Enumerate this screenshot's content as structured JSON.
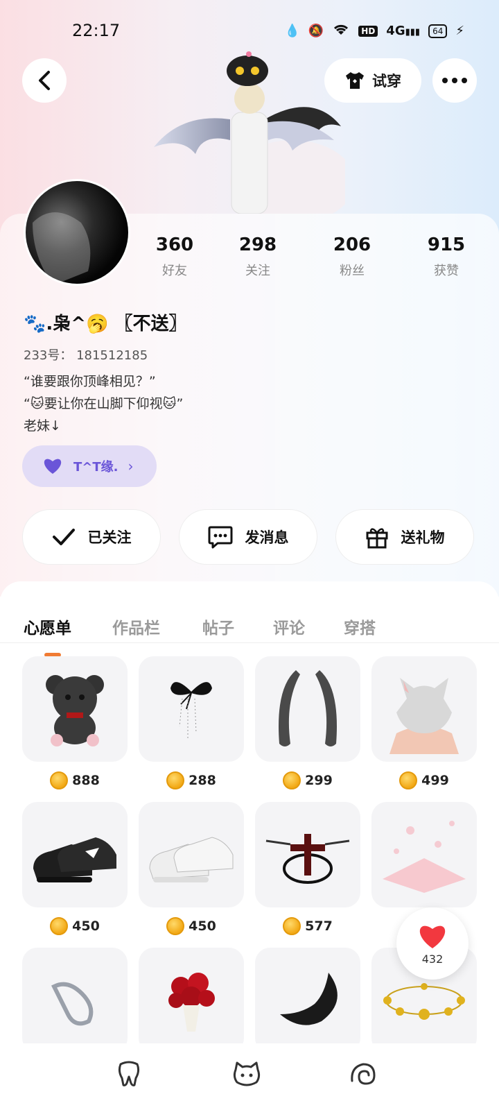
{
  "status_bar": {
    "time": "22:17",
    "network": "4G",
    "hd": "HD",
    "battery": "64"
  },
  "header": {
    "tryon_label": "试穿"
  },
  "profile": {
    "stats": [
      {
        "value": "360",
        "label": "好友"
      },
      {
        "value": "298",
        "label": "关注"
      },
      {
        "value": "206",
        "label": "粉丝"
      },
      {
        "value": "915",
        "label": "获赞"
      }
    ],
    "nickname": "🐾.枭^🥱 〖不送〗",
    "uid": "233号：  181512185",
    "bio": "“谁要跟你顶峰相见？”\n“🐱要让你在山脚下仰视🐱”\n老妹↓",
    "family_label": "T^T缘."
  },
  "actions": {
    "follow_label": "已关注",
    "message_label": "发消息",
    "gift_label": "送礼物"
  },
  "tabs": [
    "心愿单",
    "作品栏",
    "帖子",
    "评论",
    "穿搭"
  ],
  "wishlist": [
    {
      "name": "bear",
      "price": "888"
    },
    {
      "name": "butterfly-chain",
      "price": "288"
    },
    {
      "name": "horns",
      "price": "299"
    },
    {
      "name": "cat-ear-hair",
      "price": "499"
    },
    {
      "name": "black-sneakers",
      "price": "450"
    },
    {
      "name": "white-sneakers",
      "price": "450"
    },
    {
      "name": "cross-effect",
      "price": "577"
    },
    {
      "name": "sakura-effect",
      "price": ""
    },
    {
      "name": "silver-ornament",
      "price": ""
    },
    {
      "name": "rose-bouquet",
      "price": ""
    },
    {
      "name": "tail",
      "price": ""
    },
    {
      "name": "gold-beads",
      "price": ""
    }
  ],
  "like_fab": {
    "count": "432"
  },
  "colors": {
    "accent": "#f07b33",
    "family_purple": "#6a55d8",
    "coin": "#f2a916"
  }
}
